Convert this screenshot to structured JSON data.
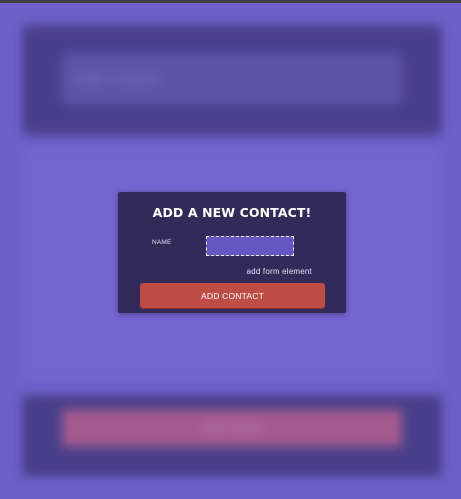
{
  "background": {
    "search_placeholder": "Enter a search",
    "footer_button_label": "Add Contact"
  },
  "modal": {
    "title": "ADD A NEW CONTACT!",
    "name_label": "NAME",
    "name_value": "",
    "add_element_link": "add form element",
    "submit_label": "ADD CONTACT"
  },
  "colors": {
    "page_bg": "#6f60c9",
    "modal_bg": "#322b5a",
    "input_bg": "#6656c2",
    "button_bg": "#c04c46"
  }
}
